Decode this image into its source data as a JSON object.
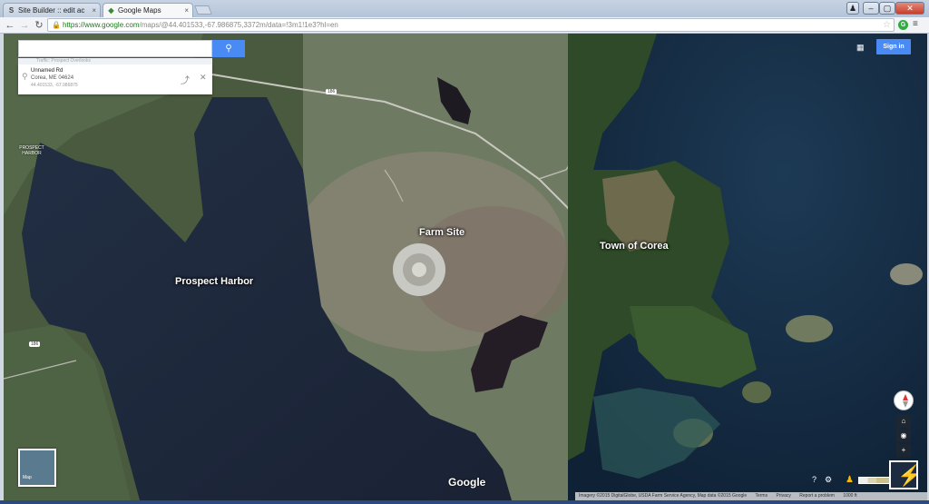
{
  "browser": {
    "tabs": [
      {
        "label": "Site Builder :: edit ac",
        "icon": "site-builder-favicon",
        "active": false
      },
      {
        "label": "Google Maps",
        "icon": "google-maps-favicon",
        "active": true
      }
    ],
    "url_secure": "https://www.google.com",
    "url_path": "/maps/@44.401533,-67.986875,3372m/data=!3m1!1e3?hl=en",
    "extension_icon_letter": "G"
  },
  "maps": {
    "search_placeholder": "",
    "search_button_icon": "search-icon",
    "card_hint": "Traffic: Prospect Overlooks",
    "place": {
      "line1": "Unnamed Rd",
      "line2": "Corea, ME 04624",
      "coords": "44.401533, -67.986875"
    },
    "signin_label": "Sign in",
    "route_badge": "186",
    "route_badge_2": "186",
    "labels": {
      "prospect_harbor": "Prospect Harbor",
      "farm_site": "Farm Site",
      "town_of_corea": "Town of Corea",
      "prospect_harbor_small_1": "PROSPECT",
      "prospect_harbor_small_2": "HARBOR"
    },
    "minimap_label": "Map",
    "google_logo": "Google",
    "controls": {
      "zoom_in": "+",
      "zoom_out": "−"
    },
    "attribution": {
      "imagery": "Imagery ©2015 DigitalGlobe, USDA Farm Service Agency, Map data ©2015 Google",
      "terms": "Terms",
      "privacy": "Privacy",
      "report": "Report a problem",
      "scale": "1000 ft"
    },
    "colors": {
      "accent": "#4a8af4",
      "water": "#1f2a3c"
    }
  }
}
